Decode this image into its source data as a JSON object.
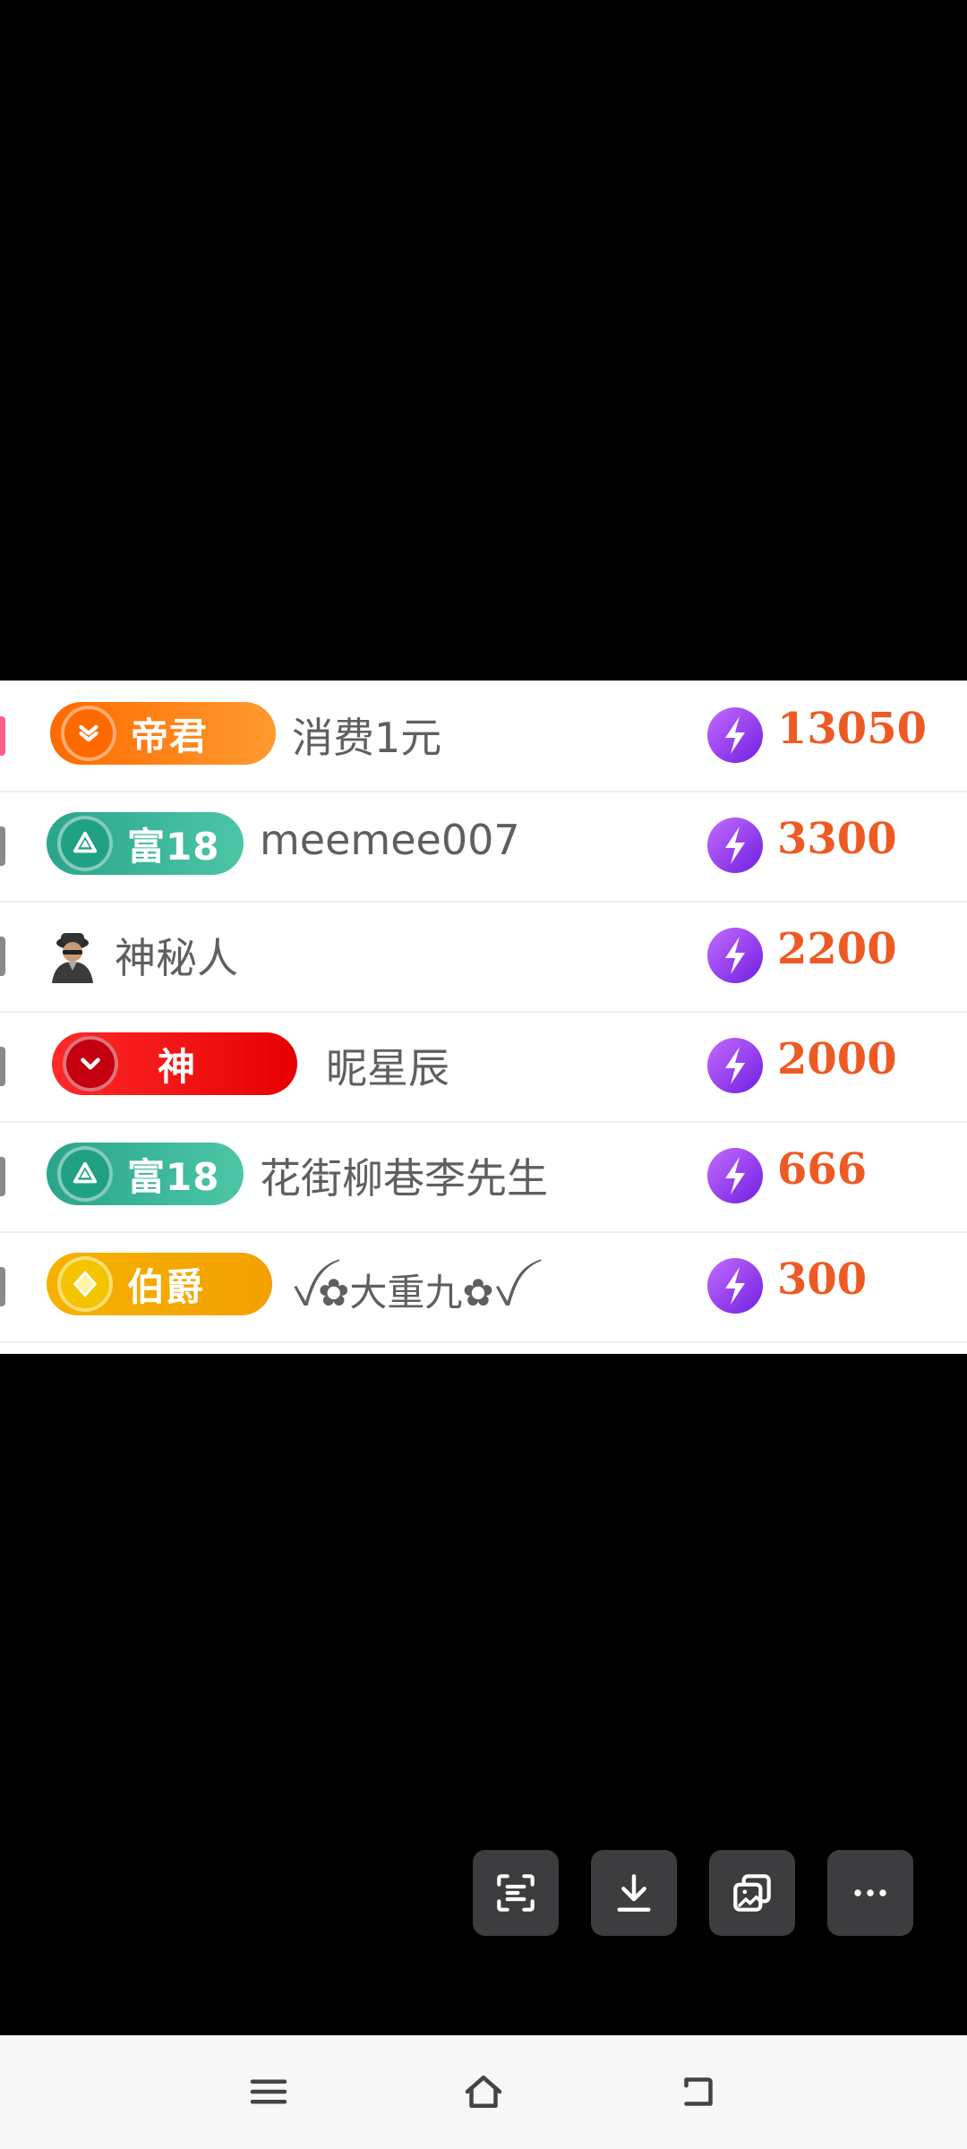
{
  "ranking_list": {
    "rows": [
      {
        "badge_label": "帝君",
        "badge_style": "orange",
        "name": "消费1元",
        "score": "13050"
      },
      {
        "badge_label": "富18",
        "badge_style": "teal",
        "name": "meemee007",
        "score": "3300"
      },
      {
        "badge_label": "",
        "badge_style": "none",
        "name": "神秘人",
        "score": "2200"
      },
      {
        "badge_label": "神",
        "badge_style": "red",
        "name": "昵星辰",
        "score": "2000"
      },
      {
        "badge_label": "富18",
        "badge_style": "teal",
        "name": "花街柳巷李先生",
        "score": "666"
      },
      {
        "badge_label": "伯爵",
        "badge_style": "gold",
        "name": "ꪜ✿大重九✿ꪜ",
        "score": "300"
      }
    ]
  },
  "floating_toolbar": {
    "items": [
      "scan-text-icon",
      "download-icon",
      "copy-image-icon",
      "more-icon"
    ]
  },
  "navigation_bar": {
    "items": [
      "menu-icon",
      "home-icon",
      "back-icon"
    ]
  },
  "colors": {
    "score": "#ee5a24",
    "name": "#5f5f5f",
    "background": "#000000",
    "panel": "#ffffff"
  }
}
